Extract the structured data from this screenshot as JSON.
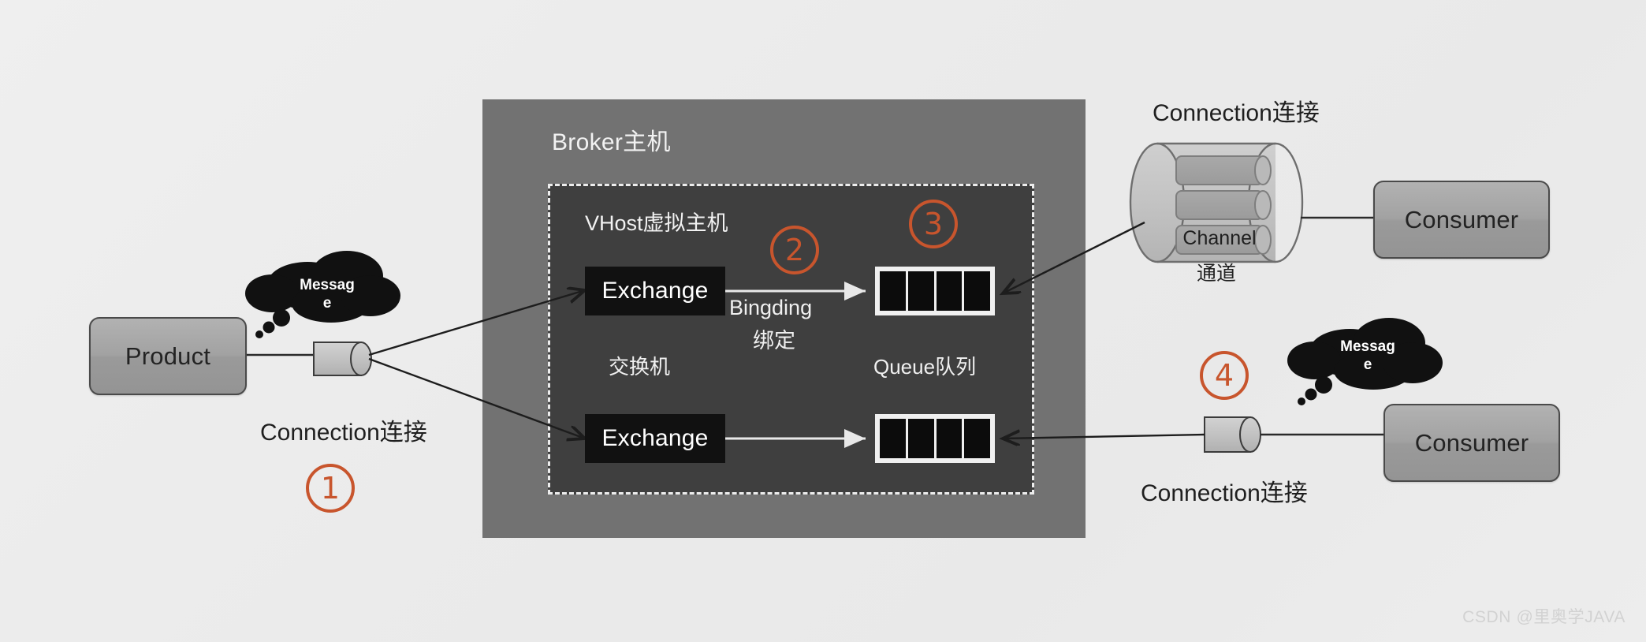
{
  "diagram": {
    "title_broker": "Broker主机",
    "title_vhost": "VHost虚拟主机",
    "watermark": "CSDN @里奥学JAVA",
    "colors": {
      "background": "#ececec",
      "broker_fill": "#727272",
      "vhost_fill": "#3f3f3f",
      "exchange_fill": "#111111",
      "queue_border": "#f0f0f0",
      "queue_cell": "#0c0c0c",
      "accent_orange": "#c8552d",
      "node_fill": "#a2a2a2",
      "node_border": "#4a4a4a",
      "cloud_fill": "#111111"
    }
  },
  "nodes": {
    "product": "Product",
    "consumer_top": "Consumer",
    "consumer_bottom": "Consumer",
    "exchange_top": "Exchange",
    "exchange_bottom": "Exchange"
  },
  "labels": {
    "binding_en": "Bingding",
    "binding_cn": "绑定",
    "exchange_cn": "交换机",
    "queue_cn": "Queue队列",
    "connection_left": "Connection连接",
    "connection_top_right": "Connection连接",
    "connection_bottom_right": "Connection连接",
    "channel_en": "Channel",
    "channel_cn": "通道"
  },
  "messages": {
    "cloud_left_line1": "Messag",
    "cloud_left_line2": "e",
    "cloud_right_line1": "Messag",
    "cloud_right_line2": "e"
  },
  "steps": {
    "one": "①",
    "two": "②",
    "three": "③",
    "four": "④",
    "one_digit": "1",
    "two_digit": "2",
    "three_digit": "3",
    "four_digit": "4"
  },
  "queues": {
    "cell_count": 4
  },
  "channel_cylinder": {
    "inner_channel_count": 3
  }
}
